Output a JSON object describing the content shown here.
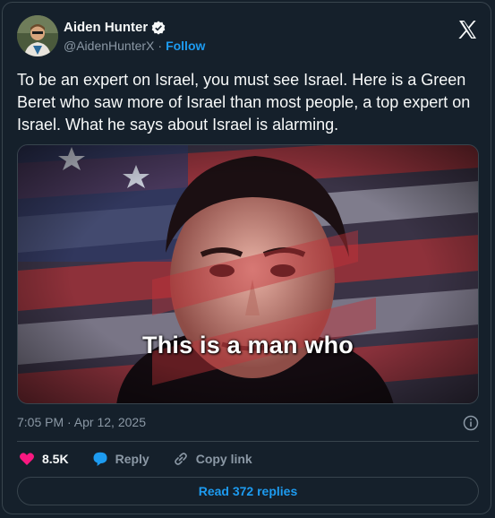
{
  "tweet": {
    "author_name": "Aiden Hunter",
    "handle": "@AidenHunterX",
    "separator": "·",
    "follow_label": "Follow",
    "text": "To be an expert on Israel, you must see Israel. Here is a Green Beret who saw more of Israel than most people, a top expert on Israel. What he says about Israel is alarming.",
    "media_caption": "This is a man who",
    "timestamp": "7:05 PM · Apr 12, 2025",
    "like_count": "8.5K",
    "reply_label": "Reply",
    "copy_link_label": "Copy link",
    "read_replies_label": "Read 372 replies"
  },
  "colors": {
    "background": "#15202b",
    "accent": "#1d9bf0",
    "like": "#f91880",
    "muted": "#8b98a5",
    "border": "#38444d"
  },
  "icons": [
    "verified-badge-icon",
    "x-logo-icon",
    "info-icon",
    "heart-icon",
    "reply-bubble-icon",
    "link-icon"
  ]
}
